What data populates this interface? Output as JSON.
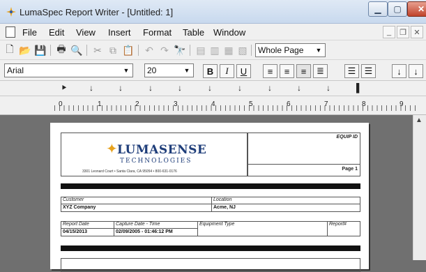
{
  "window": {
    "title": "LumaSpec Report Writer - [Untitled: 1]"
  },
  "menu": {
    "items": [
      "File",
      "Edit",
      "View",
      "Insert",
      "Format",
      "Table",
      "Window"
    ]
  },
  "toolbar": {
    "zoom_value": "Whole Page"
  },
  "format_bar": {
    "font_value": "Arial",
    "size_value": "20",
    "bold": "B",
    "italic": "I",
    "underline": "U"
  },
  "ruler": {
    "numbers": [
      "0",
      "1",
      "2",
      "3",
      "4",
      "5",
      "6",
      "7",
      "8",
      "9"
    ]
  },
  "report": {
    "brand": "LUMASENSE",
    "brand_sub": "TECHNOLOGIES",
    "address": "3301 Leonard Court • Santa Clara, CA 95054 • 800-631-0176",
    "equip_label": "EQUIP ID",
    "page_label": "Page 1",
    "customer_label": "Customer",
    "customer_value": "XYZ Company",
    "location_label": "Location",
    "location_value": "Acme, NJ",
    "report_date_label": "Report Date",
    "report_date_value": "04/15/2013",
    "capture_label": "Capture Date - Time",
    "capture_value": "02/09/2005 - 01:46:12 PM",
    "equipment_type_label": "Equipment Type",
    "report_no_label": "Report#"
  },
  "icons": [
    "new-icon",
    "open-icon",
    "save-icon",
    "print-icon",
    "preview-icon",
    "cut-icon",
    "copy-icon",
    "paste-icon",
    "undo-icon",
    "redo-icon",
    "find-icon"
  ]
}
